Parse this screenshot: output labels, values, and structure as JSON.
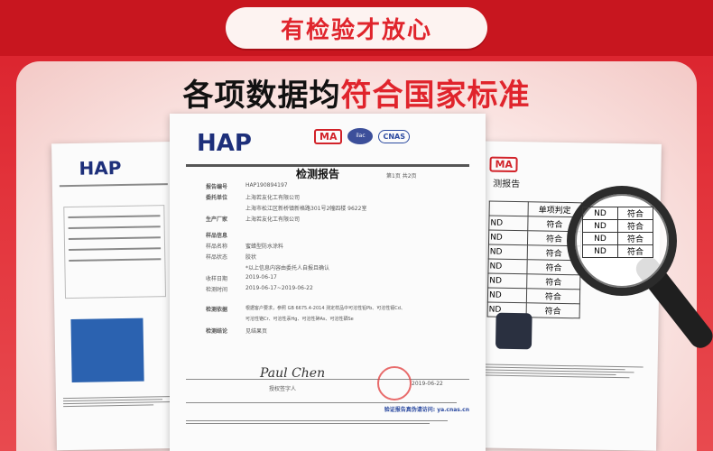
{
  "banner": {
    "text": "有检验才放心"
  },
  "headline": {
    "part1": "各项数据均",
    "part2": "符合国家标准"
  },
  "center_doc": {
    "logo": "HAP",
    "ma": "MA",
    "cnas": "CNAS",
    "title": "检测报告",
    "page": "第1页  共2页",
    "rows": [
      {
        "k": "报告编号",
        "v": "HAP190894197"
      },
      {
        "k": "委托单位",
        "v": "上海若友化工有限公司"
      },
      {
        "k": "",
        "v": "上海市松江区新桥镇新格路301号2幢四楼 9622室"
      },
      {
        "k": "生产厂家",
        "v": "上海若友化工有限公司"
      },
      {
        "k": "样品信息",
        "v": ""
      },
      {
        "k": "样品名称",
        "v": "蜜蜡型防水涂料"
      },
      {
        "k": "样品状态",
        "v": "胶状"
      },
      {
        "k": "",
        "v": "*以上信息内容由委托人自报且确认"
      },
      {
        "k": "收样日期",
        "v": "2019-06-17"
      },
      {
        "k": "检测时间",
        "v": "2019-06-17~2019-06-22"
      },
      {
        "k": "检测依据",
        "v": "根据客户要求，参照 GB 6675.4-2014 测定样品中可溶性铅Pb、可溶性镉Cd、"
      },
      {
        "k": "",
        "v": "可溶性铬Cr、可溶性汞Hg、可溶性砷As、可溶性硒Se"
      },
      {
        "k": "检测结论",
        "v": "见结果页"
      }
    ],
    "sign_label": "授权签字人",
    "signature": "Paul Chen",
    "date": "2019-06-22",
    "footer": "验证报告真伪请访问: ya.cnas.cn"
  },
  "left_doc": {
    "logo": "HAP"
  },
  "right_doc": {
    "ma": "MA",
    "title_partial": "测报告",
    "table_header": "单项判定",
    "col_left": [
      "ND",
      "ND",
      "ND",
      "ND",
      "ND",
      "ND",
      "ND"
    ],
    "col_right": [
      "符合",
      "符合",
      "符合",
      "符合",
      "符合",
      "符合",
      "符合"
    ]
  },
  "colors": {
    "brand_red": "#e0242c",
    "banner_bg": "#c8161f",
    "navy": "#1d2f7a"
  }
}
